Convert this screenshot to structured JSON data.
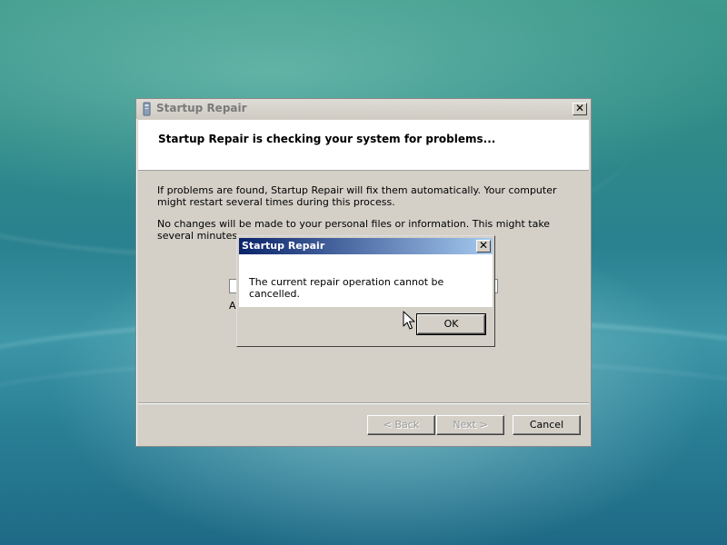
{
  "wizard": {
    "title": "Startup Repair",
    "header_title": "Startup Repair is checking your system for problems...",
    "paragraph1": "If problems are found, Startup Repair will fix them automatically. Your computer might restart several times during this process.",
    "paragraph2": "No changes will be made to your personal files or information. This might take several minutes.",
    "partial_label": "A",
    "close_glyph": "✕",
    "buttons": {
      "back": "< Back",
      "next": "Next >",
      "cancel": "Cancel"
    }
  },
  "dialog": {
    "title": "Startup Repair",
    "message": "The current repair operation cannot be cancelled.",
    "ok": "OK",
    "close_glyph": "✕"
  },
  "icons": {
    "window": "startup-repair-icon",
    "cursor": "arrow-cursor-icon"
  },
  "colors": {
    "dialog_title_start": "#0a246a",
    "dialog_title_end": "#a6caf0",
    "window_face": "#d4d0c8"
  }
}
